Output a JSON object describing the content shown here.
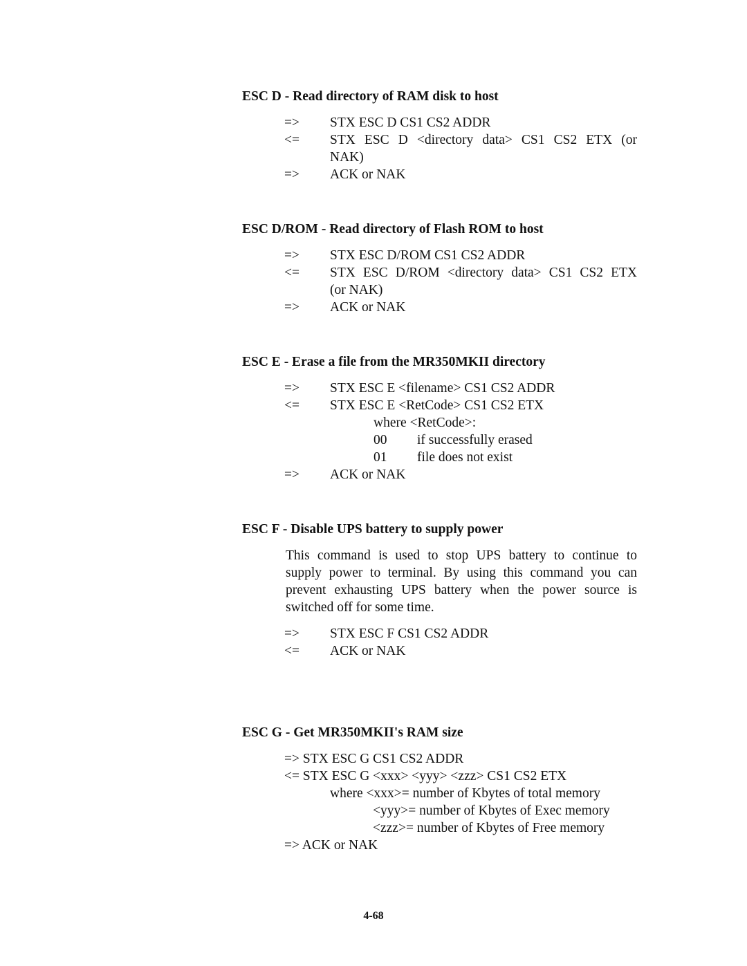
{
  "sections": [
    {
      "heading": "ESC D - Read directory of RAM disk to host",
      "lines": [
        {
          "dir": "=>",
          "text": "STX ESC D CS1 CS2 ADDR"
        },
        {
          "dir": "<=",
          "text": "STX ESC D <directory data> CS1 CS2 ETX (or",
          "cont": "NAK)"
        },
        {
          "dir": "=>",
          "text": "ACK or NAK"
        }
      ]
    },
    {
      "heading": "ESC D/ROM - Read directory of Flash ROM to host",
      "lines": [
        {
          "dir": "=>",
          "text": "STX ESC D/ROM CS1 CS2 ADDR"
        },
        {
          "dir": "<=",
          "text": "STX ESC D/ROM <directory data> CS1 CS2 ETX",
          "cont": "(or NAK)"
        },
        {
          "dir": "=>",
          "text": "ACK or NAK"
        }
      ]
    },
    {
      "heading": "ESC E - Erase a file from the MR350MKII directory",
      "lines": [
        {
          "dir": "=>",
          "text": "STX ESC E <filename> CS1 CS2 ADDR"
        },
        {
          "dir": "<=",
          "text": "STX ESC E <RetCode> CS1 CS2 ETX"
        },
        {
          "dir": "=>",
          "text": "ACK or NAK"
        }
      ],
      "where_label": "where <RetCode>:",
      "codes": [
        {
          "code": "00",
          "desc": "if successfully erased"
        },
        {
          "code": "01",
          "desc": "file does not exist"
        }
      ]
    },
    {
      "heading": "ESC F - Disable UPS battery to supply power",
      "paragraph_lines": [
        "This command is used to stop UPS battery to continue to",
        "supply power to terminal. By using this command you can",
        "prevent exhausting UPS battery when the power source is",
        "switched off for some time."
      ],
      "lines": [
        {
          "dir": "=>",
          "text": "STX ESC F CS1 CS2 ADDR"
        },
        {
          "dir": "<=",
          "text": "ACK or NAK"
        }
      ]
    },
    {
      "heading": "ESC G - Get MR350MKII's RAM size",
      "lines": [
        "=> STX ESC G CS1 CS2 ADDR",
        "<= STX ESC G <xxx> <yyy> <zzz> CS1 CS2 ETX",
        "where <xxx>= number of Kbytes of total memory",
        "<yyy>= number of Kbytes of Exec memory",
        "<zzz>= number of Kbytes of Free memory",
        "=> ACK or NAK"
      ]
    }
  ],
  "footer": {
    "page_number": "4-68"
  }
}
